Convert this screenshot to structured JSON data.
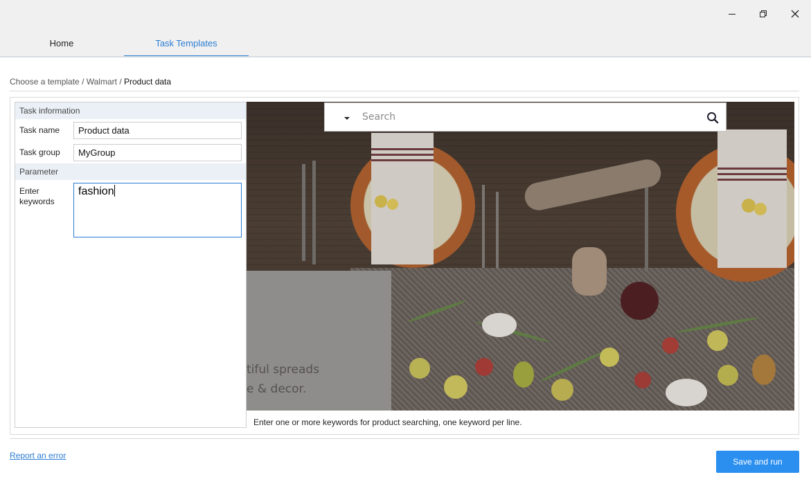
{
  "window": {
    "controls": {
      "minimize_icon": "minimize-icon",
      "restore_icon": "restore-icon",
      "close_icon": "close-icon"
    }
  },
  "tabs": [
    {
      "label": "Home",
      "active": false
    },
    {
      "label": "Task Templates",
      "active": true
    }
  ],
  "breadcrumb": {
    "items": [
      "Choose a template",
      "Walmart",
      "Product data"
    ],
    "separator": " / "
  },
  "form": {
    "task_info_header": "Task information",
    "task_name_label": "Task name",
    "task_name_value": "Product data",
    "task_group_label": "Task group",
    "task_group_value": " MyGroup",
    "parameter_header": "Parameter",
    "keywords_label": "Enter keywords",
    "keywords_value": "fashion"
  },
  "preview": {
    "search_placeholder": "Search",
    "text_line1": "tiful spreads",
    "text_line2": "e & decor."
  },
  "help_text": "Enter one or more keywords for product searching, one keyword per line.",
  "footer": {
    "report_link": "Report an error",
    "save_button": "Save and run"
  },
  "colors": {
    "accent": "#2b7cd3",
    "button": "#2b8ff0",
    "section_bg": "#eaf0f6"
  }
}
